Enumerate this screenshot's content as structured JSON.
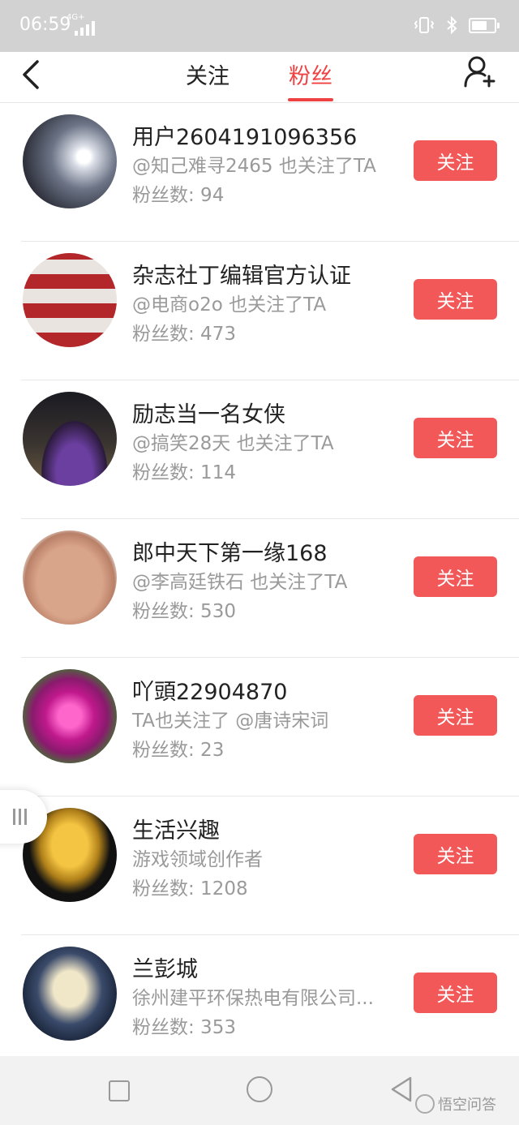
{
  "status_bar": {
    "time": "06:59",
    "network": "4G+"
  },
  "header": {
    "tabs": [
      {
        "label": "关注",
        "active": false
      },
      {
        "label": "粉丝",
        "active": true
      }
    ]
  },
  "users": [
    {
      "name": "用户2604191096356",
      "subtitle": "@知己难寻2465 也关注了TA",
      "fans": "粉丝数: 94",
      "button": "关注"
    },
    {
      "name": "杂志社丁编辑官方认证",
      "subtitle": "@电商o2o 也关注了TA",
      "fans": "粉丝数: 473",
      "button": "关注"
    },
    {
      "name": "励志当一名女侠",
      "subtitle": "@搞笑28天 也关注了TA",
      "fans": "粉丝数: 114",
      "button": "关注"
    },
    {
      "name": "郎中天下第一缘168",
      "subtitle": "@李高廷铁石 也关注了TA",
      "fans": "粉丝数: 530",
      "button": "关注"
    },
    {
      "name": "吖頭22904870",
      "subtitle": "TA也关注了 @唐诗宋词",
      "fans": "粉丝数: 23",
      "button": "关注"
    },
    {
      "name": "生活兴趣",
      "subtitle": "游戏领域创作者",
      "fans": "粉丝数: 1208",
      "button": "关注"
    },
    {
      "name": "兰彭城",
      "subtitle": "徐州建平环保热电有限公司...",
      "fans": "粉丝数: 353",
      "button": "关注"
    }
  ],
  "watermark": "悟空问答",
  "colors": {
    "accent": "#f04142",
    "button": "#f25858"
  }
}
